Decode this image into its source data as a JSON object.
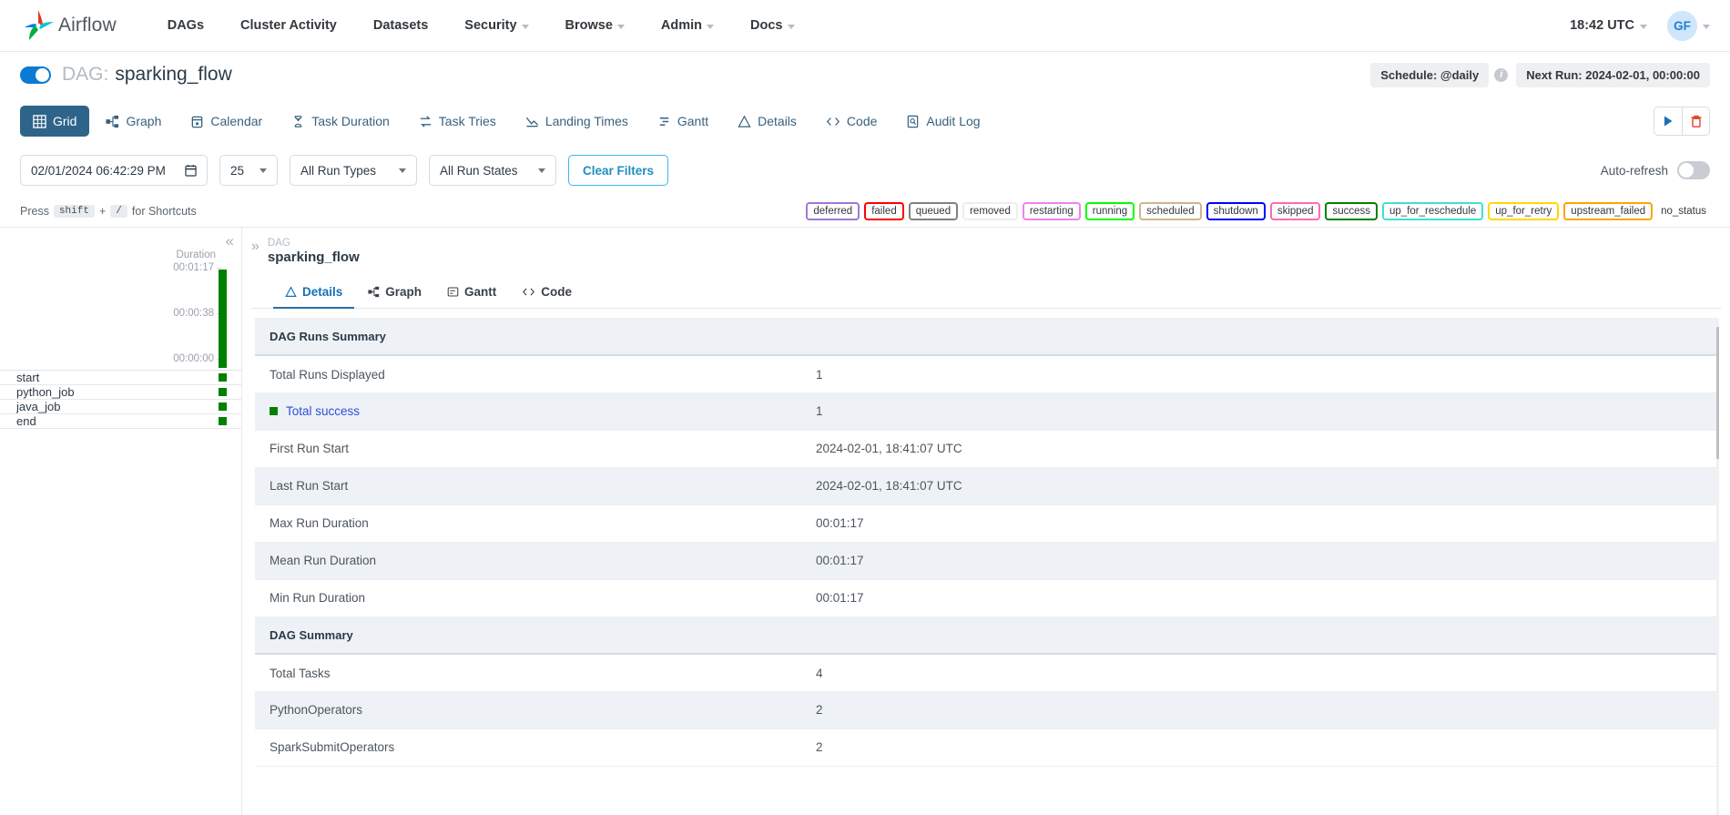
{
  "navbar": {
    "brand": "Airflow",
    "links": [
      {
        "label": "DAGs",
        "has_caret": false
      },
      {
        "label": "Cluster Activity",
        "has_caret": false
      },
      {
        "label": "Datasets",
        "has_caret": false
      },
      {
        "label": "Security",
        "has_caret": true
      },
      {
        "label": "Browse",
        "has_caret": true
      },
      {
        "label": "Admin",
        "has_caret": true
      },
      {
        "label": "Docs",
        "has_caret": true
      }
    ],
    "clock": "18:42 UTC",
    "avatar_initials": "GF"
  },
  "dag_header": {
    "prefix": "DAG:",
    "name": "sparking_flow",
    "toggle_on": true,
    "schedule": "Schedule: @daily",
    "info_glyph": "i",
    "next_run": "Next Run: 2024-02-01, 00:00:00"
  },
  "view_tabs": [
    {
      "label": "Grid",
      "icon": "grid-icon",
      "active": true
    },
    {
      "label": "Graph",
      "icon": "graph-icon",
      "active": false
    },
    {
      "label": "Calendar",
      "icon": "calendar-icon",
      "active": false
    },
    {
      "label": "Task Duration",
      "icon": "hourglass-icon",
      "active": false
    },
    {
      "label": "Task Tries",
      "icon": "retry-icon",
      "active": false
    },
    {
      "label": "Landing Times",
      "icon": "landing-icon",
      "active": false
    },
    {
      "label": "Gantt",
      "icon": "gantt-icon",
      "active": false
    },
    {
      "label": "Details",
      "icon": "triangle-icon",
      "active": false
    },
    {
      "label": "Code",
      "icon": "code-icon",
      "active": false
    },
    {
      "label": "Audit Log",
      "icon": "auditlog-icon",
      "active": false
    }
  ],
  "view_actions": {
    "trigger_label": "trigger-dag",
    "delete_label": "delete-dag",
    "trigger_color": "#1f6fb2",
    "delete_color": "#e0402a"
  },
  "filters": {
    "date_value": "02/01/2024 06:42:29 PM",
    "runs_count": "25",
    "run_types": "All Run Types",
    "run_states": "All Run States",
    "clear_label": "Clear Filters",
    "auto_refresh_label": "Auto-refresh",
    "auto_refresh_on": false
  },
  "shortcut_hint": {
    "press": "Press",
    "key1": "shift",
    "plus": "+",
    "key2": "/",
    "suffix": "for Shortcuts"
  },
  "legend": [
    {
      "label": "deferred",
      "color": "#a077d6"
    },
    {
      "label": "failed",
      "color": "#ff0000"
    },
    {
      "label": "queued",
      "color": "#808080"
    },
    {
      "label": "removed",
      "color": "#eeeeee"
    },
    {
      "label": "restarting",
      "color": "#ee82ee"
    },
    {
      "label": "running",
      "color": "#00ff00"
    },
    {
      "label": "scheduled",
      "color": "#d2b48c"
    },
    {
      "label": "shutdown",
      "color": "#0000ff"
    },
    {
      "label": "skipped",
      "color": "#ff69b4"
    },
    {
      "label": "success",
      "color": "#008000"
    },
    {
      "label": "up_for_reschedule",
      "color": "#40e0d0"
    },
    {
      "label": "up_for_retry",
      "color": "#ffd700"
    },
    {
      "label": "upstream_failed",
      "color": "#ffa500"
    },
    {
      "label": "no_status",
      "color": null
    }
  ],
  "grid_panel": {
    "collapse_glyph": "«",
    "duration_label": "Duration",
    "ticks": [
      "00:01:17",
      "00:00:38",
      "00:00:00"
    ],
    "bar_color": "#008000",
    "tasks": [
      {
        "name": "start",
        "state_color": "#008000"
      },
      {
        "name": "python_job",
        "state_color": "#008000"
      },
      {
        "name": "java_job",
        "state_color": "#008000"
      },
      {
        "name": "end",
        "state_color": "#008000"
      }
    ]
  },
  "details_panel": {
    "expand_glyph": "»",
    "eyebrow": "DAG",
    "name": "sparking_flow",
    "tabs": [
      {
        "label": "Details",
        "icon": "triangle-icon",
        "active": true
      },
      {
        "label": "Graph",
        "icon": "graph-icon",
        "active": false
      },
      {
        "label": "Gantt",
        "icon": "gantt-icon",
        "active": false
      },
      {
        "label": "Code",
        "icon": "code-icon",
        "active": false
      }
    ],
    "rows": [
      {
        "type": "section",
        "key": "DAG Runs Summary",
        "value": ""
      },
      {
        "type": "row",
        "key": "Total Runs Displayed",
        "value": "1"
      },
      {
        "type": "link",
        "key": "Total success",
        "value": "1",
        "swatch": "#008000"
      },
      {
        "type": "row",
        "key": "First Run Start",
        "value": "2024-02-01, 18:41:07 UTC"
      },
      {
        "type": "row",
        "key": "Last Run Start",
        "value": "2024-02-01, 18:41:07 UTC"
      },
      {
        "type": "row",
        "key": "Max Run Duration",
        "value": "00:01:17"
      },
      {
        "type": "row",
        "key": "Mean Run Duration",
        "value": "00:01:17"
      },
      {
        "type": "row",
        "key": "Min Run Duration",
        "value": "00:01:17"
      },
      {
        "type": "section",
        "key": "DAG Summary",
        "value": ""
      },
      {
        "type": "row",
        "key": "Total Tasks",
        "value": "4"
      },
      {
        "type": "row",
        "key": "PythonOperators",
        "value": "2"
      },
      {
        "type": "row",
        "key": "SparkSubmitOperators",
        "value": "2"
      }
    ]
  }
}
